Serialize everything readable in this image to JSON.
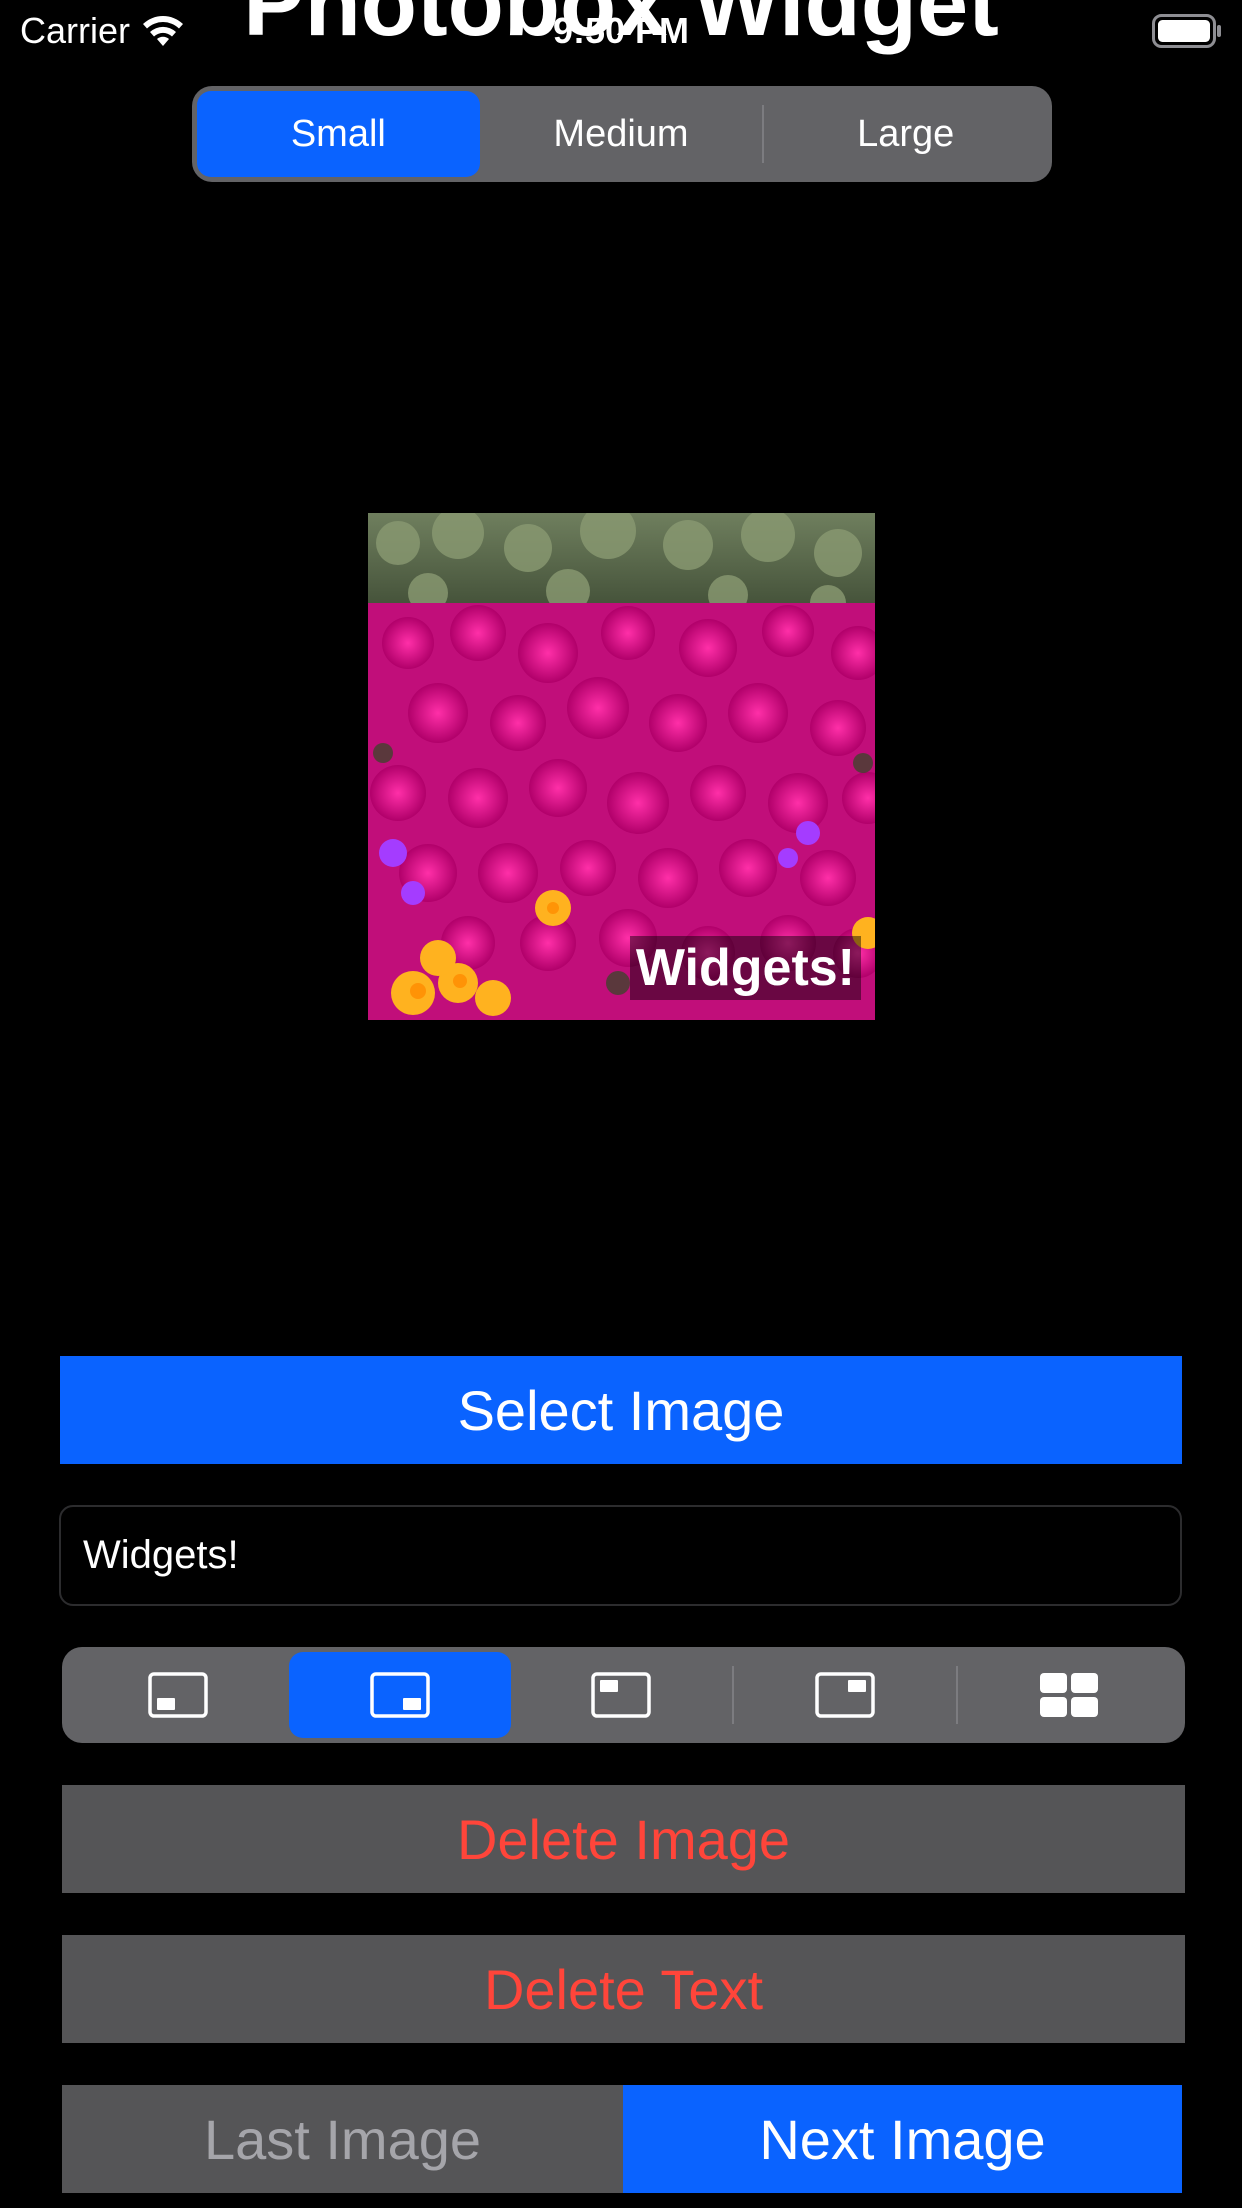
{
  "status_bar": {
    "carrier": "Carrier",
    "time": "9:50 PM"
  },
  "app": {
    "title": "Photobox Widget"
  },
  "size_picker": {
    "options": [
      "Small",
      "Medium",
      "Large"
    ],
    "selected": "Small"
  },
  "preview": {
    "caption": "Widgets!",
    "image_description_icon": "flower-photo"
  },
  "actions": {
    "select_image": "Select Image",
    "delete_image": "Delete Image",
    "delete_text": "Delete Text",
    "last_image": "Last Image",
    "next_image": "Next Image"
  },
  "caption_field": {
    "value": "Widgets!"
  },
  "caption_position_picker": {
    "options": [
      "bottom-left-icon",
      "bottom-right-icon",
      "top-left-icon",
      "top-right-icon",
      "grid-icon"
    ],
    "selected_index": 1
  },
  "colors": {
    "accent": "#0a63ff",
    "destructive": "#ff453a",
    "button_gray": "#555557",
    "segment_gray": "#636366"
  }
}
